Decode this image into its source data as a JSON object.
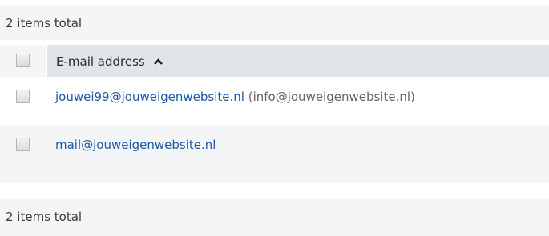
{
  "summary_top": "2 items total",
  "summary_bottom": "2 items total",
  "table": {
    "column_header": "E-mail address",
    "sort_direction": "ascending",
    "rows": [
      {
        "email": "jouwei99@jouweigenwebsite.nl",
        "alias": "(info@jouweigenwebsite.nl)"
      },
      {
        "email": "mail@jouweigenwebsite.nl",
        "alias": ""
      }
    ]
  },
  "colors": {
    "link": "#1f5aa8",
    "header_bg": "#e2e5e8",
    "stripe_bg": "#f4f5f6"
  }
}
